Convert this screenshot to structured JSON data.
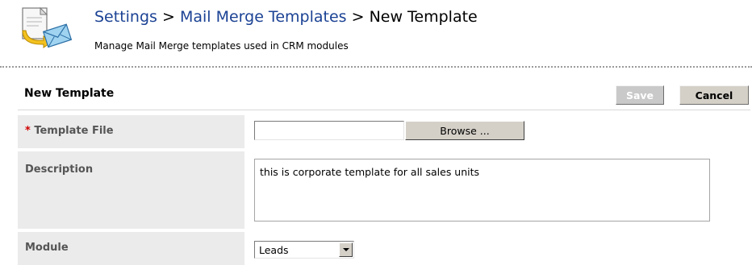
{
  "header": {
    "breadcrumb": {
      "settings": "Settings",
      "sep1": ">",
      "mail_merge_templates": "Mail Merge Templates",
      "sep2": ">",
      "current": "New Template"
    },
    "subtitle": "Manage Mail Merge templates used in CRM modules",
    "icon": "mail-merge-envelope-icon"
  },
  "section": {
    "title": "New Template",
    "save_label": "Save",
    "cancel_label": "Cancel"
  },
  "form": {
    "template_file": {
      "required_marker": "*",
      "label": "Template File",
      "value": "",
      "browse_label": "Browse ..."
    },
    "description": {
      "label": "Description",
      "value": "this is corporate template for all sales units"
    },
    "module": {
      "label": "Module",
      "selected": "Leads"
    }
  },
  "colors": {
    "link": "#1b4294",
    "label_bg": "#ebebeb",
    "required": "#d10000",
    "button_face": "#d4d0c8"
  }
}
